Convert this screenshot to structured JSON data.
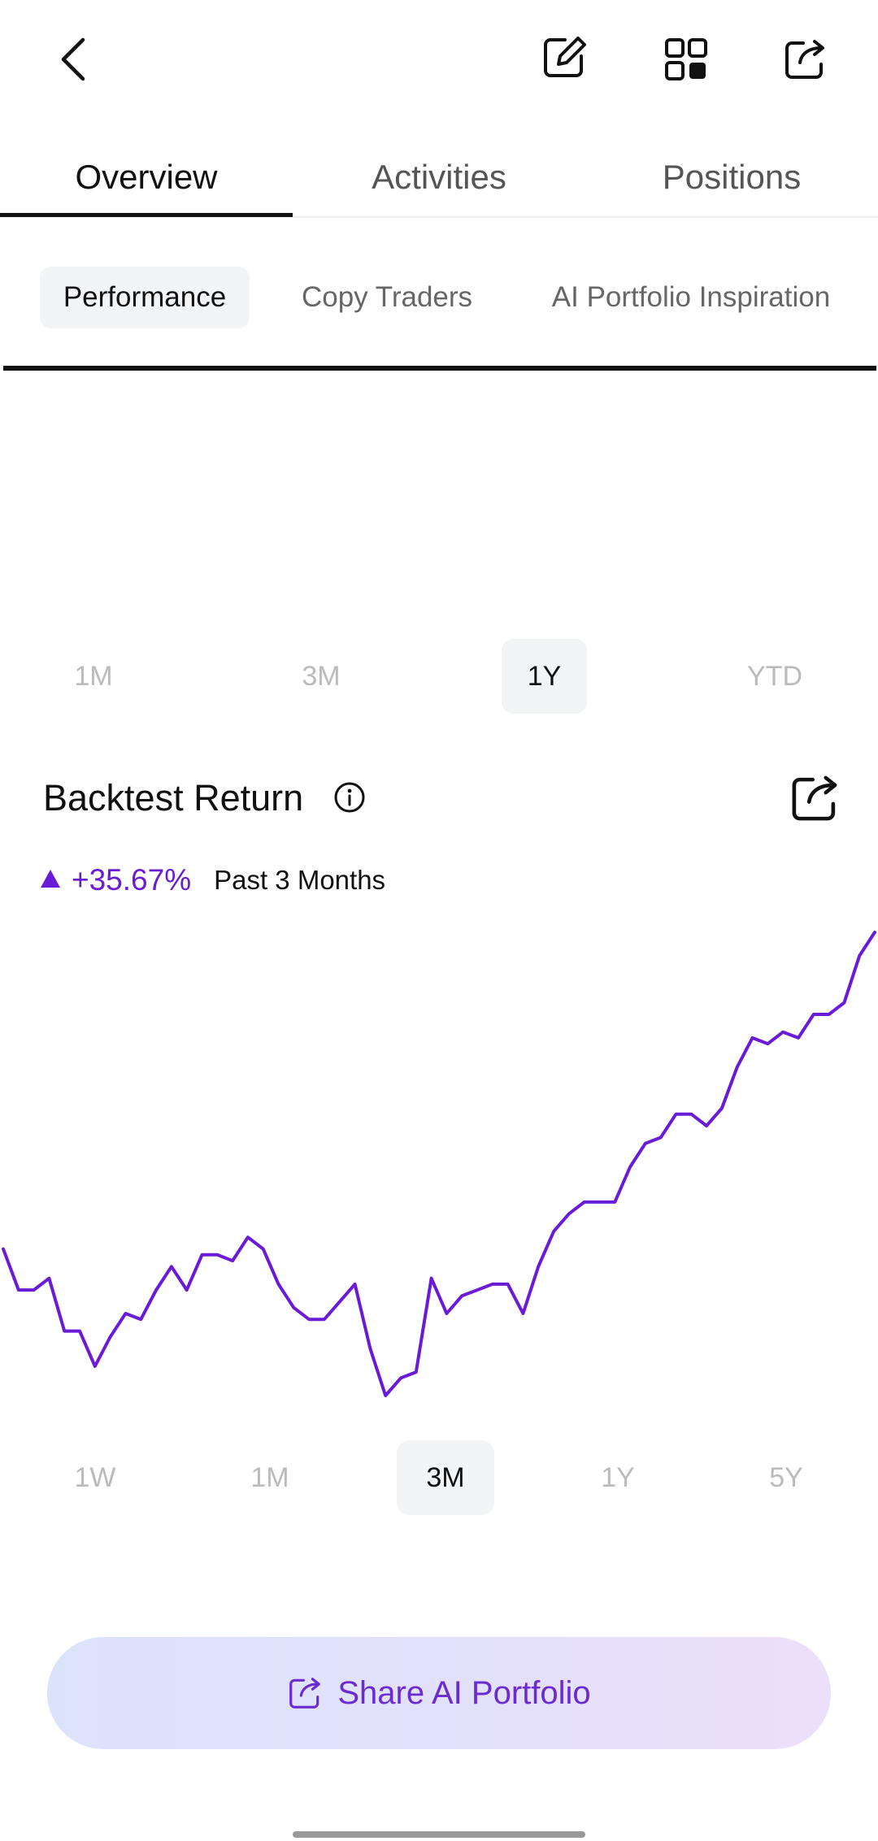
{
  "header": {
    "icons": [
      "back-chevron-icon",
      "edit-icon",
      "grid-icon",
      "share-icon"
    ]
  },
  "main_tabs": [
    {
      "label": "Overview",
      "active": true
    },
    {
      "label": "Activities",
      "active": false
    },
    {
      "label": "Positions",
      "active": false
    }
  ],
  "sub_tabs": [
    {
      "label": "Performance",
      "active": true
    },
    {
      "label": "Copy Traders",
      "active": false
    },
    {
      "label": "AI Portfolio Inspiration",
      "active": false
    }
  ],
  "period_options": [
    {
      "label": "1M",
      "active": false
    },
    {
      "label": "3M",
      "active": false
    },
    {
      "label": "1Y",
      "active": true
    },
    {
      "label": "YTD",
      "active": false
    }
  ],
  "backtest": {
    "title": "Backtest Return",
    "return_value": "+35.67%",
    "return_period": "Past 3 Months",
    "accent_color": "#6a1bd6"
  },
  "chart_data": {
    "type": "line",
    "title": "Backtest Return",
    "color": "#6a1bd6",
    "grid": false,
    "y_relative": [
      58,
      51,
      51,
      53,
      44,
      44,
      38,
      43,
      47,
      46,
      51,
      55,
      51,
      57,
      57,
      56,
      60,
      58,
      52,
      48,
      46,
      46,
      49,
      52,
      41,
      33,
      36,
      37,
      53,
      47,
      50,
      51,
      52,
      52,
      47,
      55,
      61,
      64,
      66,
      66,
      66,
      72,
      76,
      77,
      81,
      81,
      79,
      82,
      89,
      94,
      93,
      95,
      94,
      98,
      98,
      100,
      108,
      112
    ]
  },
  "range_options": [
    {
      "label": "1W",
      "active": false
    },
    {
      "label": "1M",
      "active": false
    },
    {
      "label": "3M",
      "active": true
    },
    {
      "label": "1Y",
      "active": false
    },
    {
      "label": "5Y",
      "active": false
    }
  ],
  "share_button": {
    "label": "Share AI Portfolio",
    "gradient": [
      "#dbe3fb",
      "#ecdff9"
    ],
    "text_color": "#6a2bd2"
  }
}
